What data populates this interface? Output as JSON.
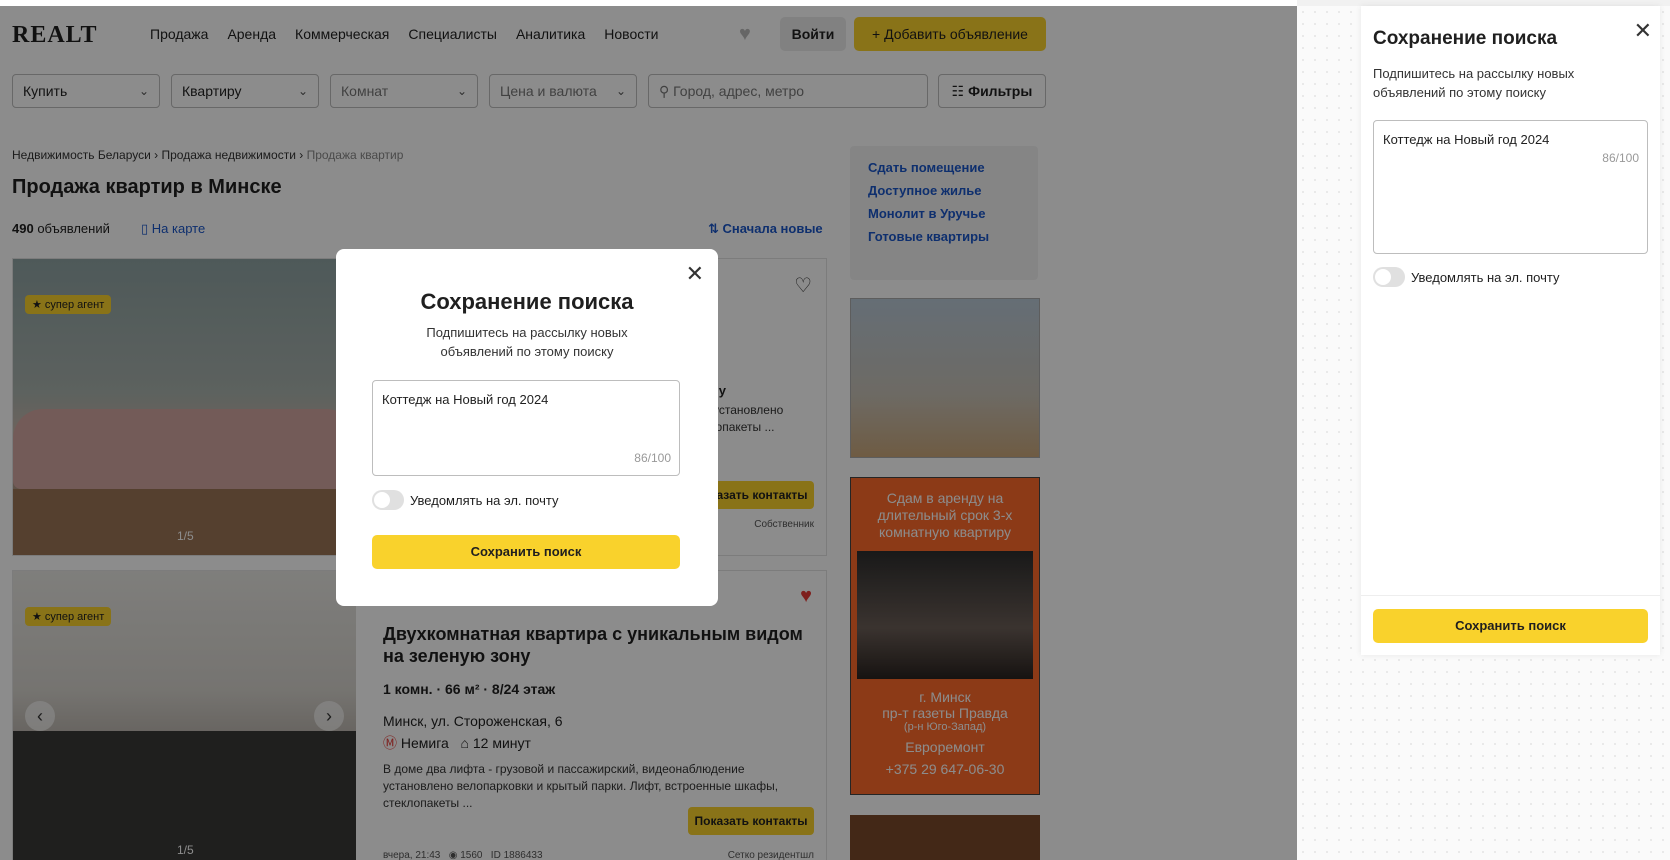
{
  "header": {
    "logo": "REALT",
    "nav": [
      "Продажа",
      "Аренда",
      "Коммерческая",
      "Специалисты",
      "Аналитика",
      "Новости"
    ],
    "login": "Войти",
    "add_listing": "Добавить объявление"
  },
  "filters": {
    "deal": "Купить",
    "type": "Квартиру",
    "rooms": "Комнат",
    "price": "Цена и валюта",
    "location_placeholder": "Город, адрес, метро",
    "filters_button": "Фильтры"
  },
  "breadcrumbs": [
    "Недвижимость Беларуси",
    "Продажа недвижимости",
    "Продажа квартир"
  ],
  "page_title": "Продажа квартир в Минске",
  "listing_meta": {
    "count": "490",
    "count_label": "объявлений",
    "map_link": "На карте",
    "sort": "Сначала новые"
  },
  "listings": [
    {
      "badge": "★ супер агент",
      "photo_counter": "1/5",
      "title_tail": "ону",
      "desc_tail": "е установлено",
      "desc_tail2": "клопакеты ...",
      "contacts": "Показать контакты",
      "owner": "Собственник"
    },
    {
      "badge": "★ супер агент",
      "photo_counter": "1/5",
      "title": "Двухкомнатная квартира с уникальным видом на зеленую зону",
      "params": "1 комн. · 66 м² · 8/24 этаж",
      "address": "Минск, ул. Стороженская, 6",
      "metro": "Немига",
      "walk": "12 минут",
      "description": "В доме два лифта - грузовой и пассажирский, видеонаблюдение установлено велопарковки и крытый парки. Лифт, встроенные шкафы, стеклопакеты ...",
      "contacts": "Показать контакты",
      "date": "вчера, 21:43",
      "views": "1560",
      "id": "ID 1886433",
      "owner": "Сетко резидентшл"
    }
  ],
  "promo_links": [
    "Сдать помещение",
    "Доступное жилье",
    "Монолит в Уручье",
    "Готовые квартиры"
  ],
  "ad_banner": {
    "headline": "Сдам в аренду на длительный срок 3-х комнатную квартиру",
    "city": "г. Минск",
    "street": "пр-т газеты Правда",
    "district": "(р-н Юго-Запад)",
    "renovation": "Евроремонт",
    "phone": "+375 29 647-06-30"
  },
  "modal": {
    "title": "Сохранение поиска",
    "subtitle": "Подпишитесь на рассылку новых объявлений по этому поиску",
    "input_value": "Коттедж на Новый год 2024",
    "counter": "86/100",
    "email_toggle_label": "Уведомлять на эл. почту",
    "save_button": "Сохранить поиск"
  },
  "side_panel": {
    "title": "Сохранение поиска",
    "subtitle": "Подпишитесь на рассылку новых объявлений по этому поиску",
    "input_value": "Коттедж на Новый год 2024",
    "counter": "86/100",
    "email_toggle_label": "Уведомлять на эл. почту",
    "save_button": "Сохранить поиск"
  }
}
